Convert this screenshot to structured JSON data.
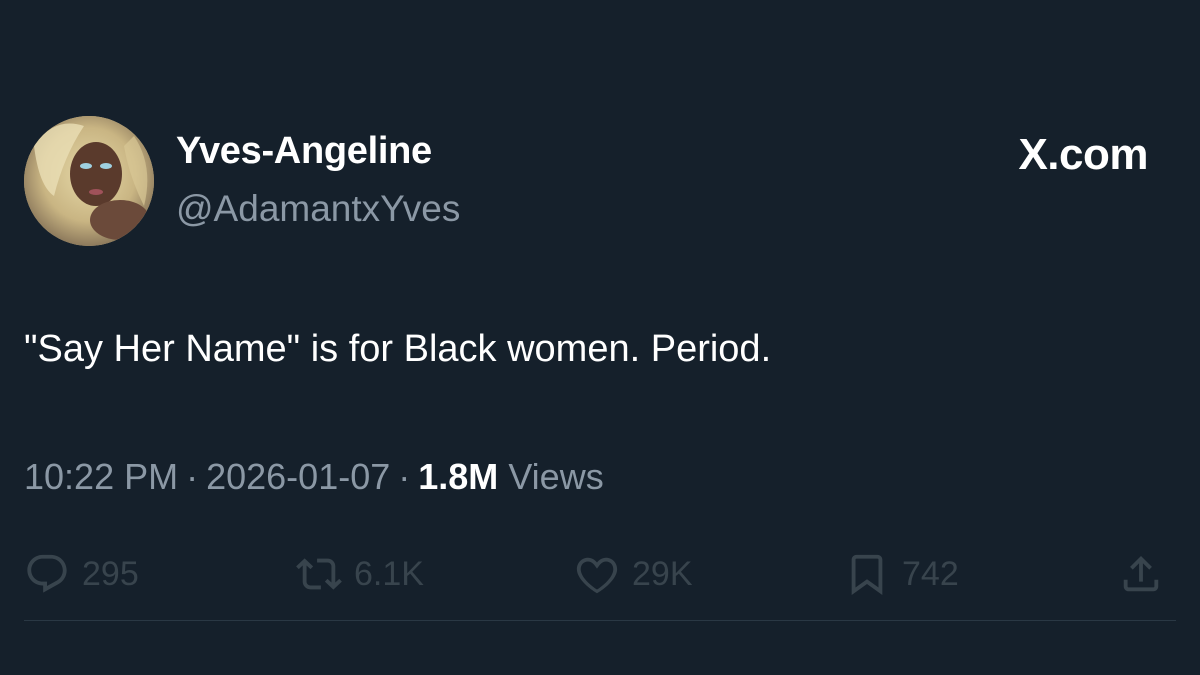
{
  "author": {
    "display_name": "Yves-Angeline",
    "handle": "@AdamantxYves"
  },
  "brand": {
    "label": "X.com"
  },
  "tweet": {
    "text": "\"Say Her Name\" is for Black women. Period."
  },
  "meta": {
    "time": "10:22 PM",
    "separator": "·",
    "date": "2026-01-07",
    "views_count": "1.8M",
    "views_label": "Views"
  },
  "actions": {
    "replies": {
      "icon": "reply-icon",
      "count": "295"
    },
    "reposts": {
      "icon": "repost-icon",
      "count": "6.1K"
    },
    "likes": {
      "icon": "heart-icon",
      "count": "29K"
    },
    "bookmarks": {
      "icon": "bookmark-icon",
      "count": "742"
    },
    "share": {
      "icon": "share-icon"
    }
  },
  "colors": {
    "background": "#15202b",
    "primary_text": "#ffffff",
    "secondary_text": "#8b98a5",
    "action_icons": "#38444d"
  }
}
